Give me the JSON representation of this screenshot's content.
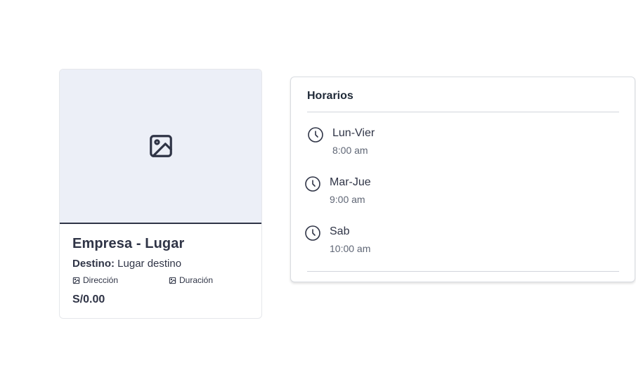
{
  "card": {
    "image_icon": "image-placeholder-icon",
    "title": "Empresa - Lugar",
    "destination_label": "Destino:",
    "destination_value": "Lugar destino",
    "address_icon": "image-icon",
    "address_label": "Dirección",
    "duration_icon": "image-icon",
    "duration_label": "Duración",
    "price": "S/0.00"
  },
  "schedule": {
    "title": "Horarios",
    "items": [
      {
        "icon": "clock-icon",
        "day": "Lun-Vier",
        "time": "8:00 am"
      },
      {
        "icon": "clock-icon",
        "day": "Mar-Jue",
        "time": "9:00 am"
      },
      {
        "icon": "clock-icon",
        "day": "Sab",
        "time": "10:00 am"
      }
    ]
  },
  "colors": {
    "image_bg": "#eceff7",
    "text_dark": "#2f3446",
    "text_muted": "#5f6675",
    "border": "#d9dce1"
  }
}
